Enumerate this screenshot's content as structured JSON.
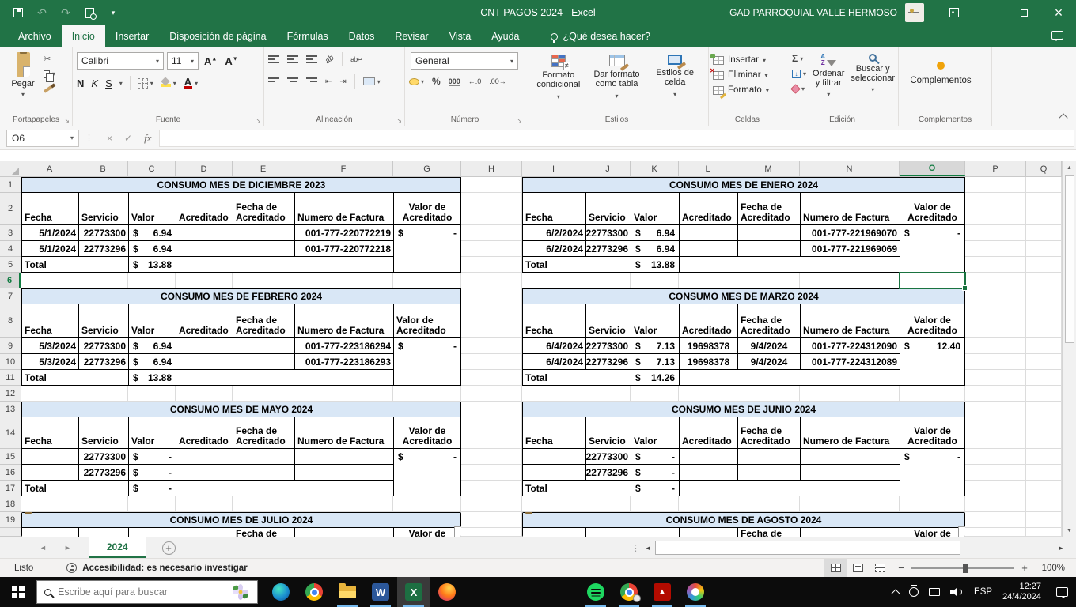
{
  "titlebar": {
    "title": "CNT PAGOS 2024  -  Excel",
    "account": "GAD PARROQUIAL VALLE HERMOSO"
  },
  "menu": {
    "tabs": [
      "Archivo",
      "Inicio",
      "Insertar",
      "Disposición de página",
      "Fórmulas",
      "Datos",
      "Revisar",
      "Vista",
      "Ayuda"
    ],
    "tell_me": "¿Qué desea hacer?"
  },
  "ribbon": {
    "clipboard": {
      "label": "Portapapeles",
      "paste": "Pegar"
    },
    "font": {
      "label": "Fuente",
      "name": "Calibri",
      "size": "11",
      "bold": "N",
      "italic": "K",
      "underline": "S",
      "grow": "A",
      "shrink": "A"
    },
    "alignment": {
      "label": "Alineación",
      "wrap": "ab",
      "orient": "ab"
    },
    "number": {
      "label": "Número",
      "format": "General",
      "percent": "%",
      "thousands": "000",
      "dec_inc": "←.0",
      "dec_dec": ".00→"
    },
    "styles": {
      "label": "Estilos",
      "conditional": "Formato condicional",
      "as_table": "Dar formato como tabla",
      "cell_styles": "Estilos de celda"
    },
    "cells": {
      "label": "Celdas",
      "insert": "Insertar",
      "del": "Eliminar",
      "format": "Formato"
    },
    "editing": {
      "label": "Edición",
      "sort": "Ordenar y filtrar",
      "find": "Buscar y seleccionar"
    },
    "addins": {
      "label": "Complementos",
      "button": "Complementos"
    }
  },
  "formula_bar": {
    "name_box": "O6",
    "fx": "fx",
    "value": ""
  },
  "grid": {
    "selected_col": "O",
    "selected_row": "6",
    "columns": [
      {
        "l": "A",
        "w": 72
      },
      {
        "l": "B",
        "w": 63
      },
      {
        "l": "C",
        "w": 60
      },
      {
        "l": "D",
        "w": 72
      },
      {
        "l": "E",
        "w": 78
      },
      {
        "l": "F",
        "w": 125
      },
      {
        "l": "G",
        "w": 86
      },
      {
        "l": "H",
        "w": 77
      },
      {
        "l": "I",
        "w": 80
      },
      {
        "l": "J",
        "w": 57
      },
      {
        "l": "K",
        "w": 61
      },
      {
        "l": "L",
        "w": 74
      },
      {
        "l": "M",
        "w": 79
      },
      {
        "l": "N",
        "w": 126
      },
      {
        "l": "O",
        "w": 83
      },
      {
        "l": "P",
        "w": 77
      },
      {
        "l": "Q",
        "w": 45
      }
    ],
    "rows": [
      {
        "n": "1",
        "h": 20
      },
      {
        "n": "2",
        "h": 41
      },
      {
        "n": "3",
        "h": 20
      },
      {
        "n": "4",
        "h": 20
      },
      {
        "n": "5",
        "h": 20
      },
      {
        "n": "6",
        "h": 20
      },
      {
        "n": "7",
        "h": 20
      },
      {
        "n": "8",
        "h": 43
      },
      {
        "n": "9",
        "h": 20
      },
      {
        "n": "10",
        "h": 20
      },
      {
        "n": "11",
        "h": 20
      },
      {
        "n": "12",
        "h": 20
      },
      {
        "n": "13",
        "h": 20
      },
      {
        "n": "14",
        "h": 40
      },
      {
        "n": "15",
        "h": 20
      },
      {
        "n": "16",
        "h": 20
      },
      {
        "n": "17",
        "h": 20
      },
      {
        "n": "18",
        "h": 20
      },
      {
        "n": "19",
        "h": 20
      },
      {
        "n": "",
        "h": 11
      }
    ]
  },
  "labels": {
    "total": "Total",
    "cur": "$"
  },
  "headers": [
    "Fecha",
    "Servicio",
    "Valor",
    "Acreditado",
    "Fecha de Acreditado",
    "Numero de Factura",
    "Valor de Acreditado"
  ],
  "tables": [
    {
      "title": "CONSUMO MES DE DICIEMBRE 2023",
      "rows": [
        {
          "fecha": "5/1/2024",
          "servicio": "22773300",
          "valor": "6.94",
          "acreditado": "",
          "fecha_acr": "",
          "factura": "001-777-220772219"
        },
        {
          "fecha": "5/1/2024",
          "servicio": "22773296",
          "valor": "6.94",
          "acreditado": "",
          "fecha_acr": "",
          "factura": "001-777-220772218"
        }
      ],
      "total": "13.88",
      "va": "-"
    },
    {
      "title": "CONSUMO MES DE ENERO 2024",
      "rows": [
        {
          "fecha": "6/2/2024",
          "servicio": "22773300",
          "valor": "6.94",
          "acreditado": "",
          "fecha_acr": "",
          "factura": "001-777-221969070"
        },
        {
          "fecha": "6/2/2024",
          "servicio": "22773296",
          "valor": "6.94",
          "acreditado": "",
          "fecha_acr": "",
          "factura": "001-777-221969069"
        }
      ],
      "total": "13.88",
      "va": "-"
    },
    {
      "title": "CONSUMO MES DE FEBRERO 2024",
      "rows": [
        {
          "fecha": "5/3/2024",
          "servicio": "22773300",
          "valor": "6.94",
          "acreditado": "",
          "fecha_acr": "",
          "factura": "001-777-223186294"
        },
        {
          "fecha": "5/3/2024",
          "servicio": "22773296",
          "valor": "6.94",
          "acreditado": "",
          "fecha_acr": "",
          "factura": "001-777-223186293"
        }
      ],
      "total": "13.88",
      "va": "-"
    },
    {
      "title": "CONSUMO MES DE MARZO 2024",
      "rows": [
        {
          "fecha": "6/4/2024",
          "servicio": "22773300",
          "valor": "7.13",
          "acreditado": "19698378",
          "fecha_acr": "9/4/2024",
          "factura": "001-777-224312090"
        },
        {
          "fecha": "6/4/2024",
          "servicio": "22773296",
          "valor": "7.13",
          "acreditado": "19698378",
          "fecha_acr": "9/4/2024",
          "factura": "001-777-224312089"
        }
      ],
      "total": "14.26",
      "va": "12.40"
    },
    {
      "title": "CONSUMO MES DE MAYO 2024",
      "rows": [
        {
          "fecha": "",
          "servicio": "22773300",
          "valor": "-",
          "acreditado": "",
          "fecha_acr": "",
          "factura": ""
        },
        {
          "fecha": "",
          "servicio": "22773296",
          "valor": "-",
          "acreditado": "",
          "fecha_acr": "",
          "factura": ""
        }
      ],
      "total": "-",
      "va": "-"
    },
    {
      "title": "CONSUMO MES DE JUNIO 2024",
      "rows": [
        {
          "fecha": "",
          "servicio": "22773300",
          "valor": "-",
          "acreditado": "",
          "fecha_acr": "",
          "factura": ""
        },
        {
          "fecha": "",
          "servicio": "22773296",
          "valor": "-",
          "acreditado": "",
          "fecha_acr": "",
          "factura": ""
        }
      ],
      "total": "-",
      "va": "-"
    },
    {
      "title": "CONSUMO MES DE JULIO 2024"
    },
    {
      "title": "CONSUMO MES DE AGOSTO 2024"
    }
  ],
  "sheet": {
    "tab": "2024"
  },
  "status": {
    "ready": "Listo",
    "accessibility": "Accesibilidad: es necesario investigar",
    "zoom": "100%"
  },
  "taskbar": {
    "search_placeholder": "Escribe aquí para buscar",
    "lang": "ESP",
    "time": "12:27",
    "date": "24/4/2024"
  },
  "icons": {
    "undo": "↶",
    "redo": "↷",
    "caret": "▾",
    "check": "✓",
    "close": "×",
    "dots": "⋮",
    "sum": "Σ",
    "launcher": "↘",
    "up": "▲",
    "down": "▼",
    "left": "◄",
    "right": "►",
    "scissors": "✂",
    "word_letter": "W",
    "excel_letter": "X",
    "acrobat_mark": "▲",
    "plus": "+",
    "minus": "−",
    "arrow_down": "↓"
  }
}
